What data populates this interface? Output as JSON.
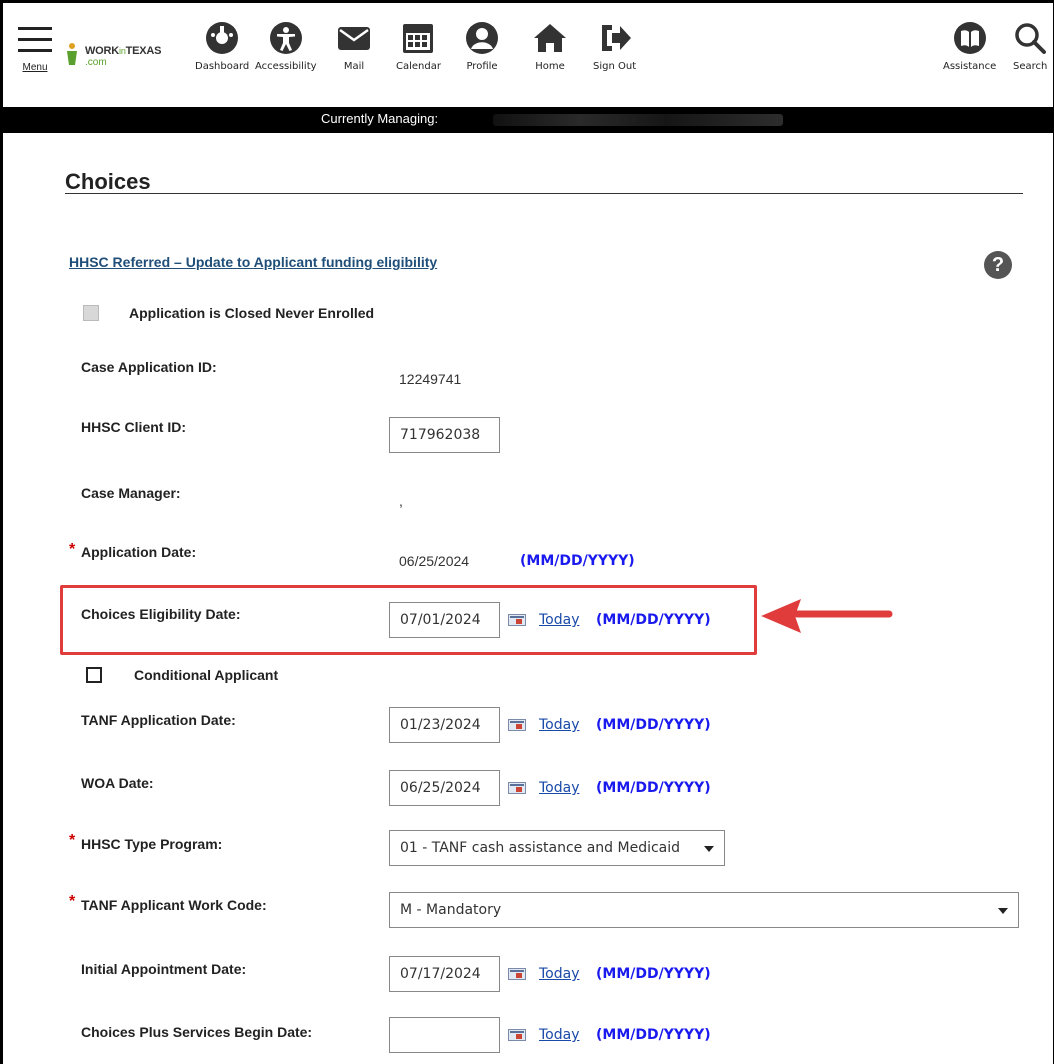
{
  "nav": {
    "menu_label": "Menu",
    "logo_brand_work": "WORK",
    "logo_brand_in": "in",
    "logo_brand_texas": "TEXAS",
    "logo_com": ".com",
    "items": [
      {
        "label": "Dashboard"
      },
      {
        "label": "Accessibility"
      },
      {
        "label": "Mail"
      },
      {
        "label": "Calendar"
      },
      {
        "label": "Profile"
      },
      {
        "label": "Home"
      },
      {
        "label": "Sign Out"
      },
      {
        "label": "Assistance"
      },
      {
        "label": "Search"
      }
    ]
  },
  "banner": {
    "text": "Currently Managing:"
  },
  "page": {
    "title": "Choices",
    "section_link": "HHSC Referred – Update to Applicant funding eligibility",
    "help_glyph": "?"
  },
  "form": {
    "closed_never_enrolled": {
      "label": "Application is Closed Never Enrolled",
      "checked": false,
      "disabled": true
    },
    "case_application_id": {
      "label": "Case Application ID:",
      "value": "12249741"
    },
    "hhsc_client_id": {
      "label": "HHSC Client ID:",
      "value": "717962038"
    },
    "case_manager": {
      "label": "Case Manager:",
      "value": ","
    },
    "application_date": {
      "label": "Application Date:",
      "value": "06/25/2024",
      "format": "(MM/DD/YYYY)",
      "required_mark": "*"
    },
    "choices_eligibility_date": {
      "label": "Choices Eligibility Date:",
      "value": "07/01/2024",
      "today": "Today",
      "format": "(MM/DD/YYYY)"
    },
    "conditional_applicant": {
      "label": "Conditional Applicant",
      "checked": false
    },
    "tanf_application_date": {
      "label": "TANF Application Date:",
      "value": "01/23/2024",
      "today": "Today",
      "format": "(MM/DD/YYYY)"
    },
    "woa_date": {
      "label": "WOA Date:",
      "value": "06/25/2024",
      "today": "Today",
      "format": "(MM/DD/YYYY)"
    },
    "hhsc_type_program": {
      "label": "HHSC Type Program:",
      "value": "01 - TANF cash assistance and Medicaid",
      "required_mark": "*"
    },
    "tanf_applicant_work_code": {
      "label": "TANF Applicant Work Code:",
      "value": "M - Mandatory",
      "required_mark": "*"
    },
    "initial_appointment_date": {
      "label": "Initial Appointment Date:",
      "value": "07/17/2024",
      "today": "Today",
      "format": "(MM/DD/YYYY)"
    },
    "choices_plus_services_begin_date": {
      "label": "Choices Plus Services Begin Date:",
      "value": "",
      "today": "Today",
      "format": "(MM/DD/YYYY)"
    }
  },
  "colors": {
    "highlight": "#e03c3c",
    "link": "#1f4e79",
    "format_text": "#1a1aee",
    "required": "#cc0000"
  }
}
